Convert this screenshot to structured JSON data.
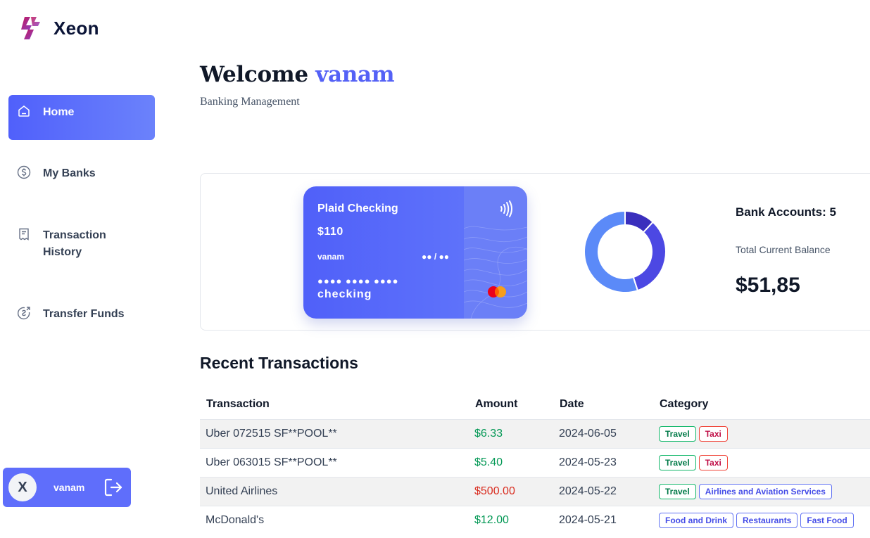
{
  "app": {
    "name": "Xeon"
  },
  "sidebar": {
    "items": [
      {
        "label": "Home",
        "icon": "home-icon",
        "active": true
      },
      {
        "label": "My Banks",
        "icon": "dollar-circle-icon"
      },
      {
        "label": "Transaction History",
        "icon": "receipt-icon"
      },
      {
        "label": "Transfer Funds",
        "icon": "money-send-icon"
      }
    ]
  },
  "user": {
    "initial": "X",
    "name": "vanam"
  },
  "header": {
    "welcome": "Welcome",
    "username": "vanam",
    "subtitle": "Banking Management"
  },
  "card": {
    "name": "Plaid Checking",
    "amount": "$110",
    "holder": "vanam",
    "expiry": "●● / ●●",
    "number_mask": "●●●● ●●●● ●●●●",
    "type": "checking"
  },
  "balance": {
    "accounts_label": "Bank Accounts: 5",
    "total_label": "Total Current Balance",
    "total_value": "$51,85"
  },
  "chart_data": {
    "type": "pie",
    "donut": true,
    "values": [
      12,
      33,
      55
    ],
    "colors": [
      "#3a2fbd",
      "#4c48e3",
      "#5b8af8"
    ]
  },
  "transactions": {
    "title": "Recent Transactions",
    "headers": [
      "Transaction",
      "Amount",
      "Date",
      "Category"
    ],
    "rows": [
      {
        "name": "Uber 072515 SF**POOL**",
        "amount": "$6.33",
        "type": "pos",
        "date": "2024-06-05",
        "tags": [
          {
            "label": "Travel",
            "color": "green"
          },
          {
            "label": "Taxi",
            "color": "red"
          }
        ]
      },
      {
        "name": "Uber 063015 SF**POOL**",
        "amount": "$5.40",
        "type": "pos",
        "date": "2024-05-23",
        "tags": [
          {
            "label": "Travel",
            "color": "green"
          },
          {
            "label": "Taxi",
            "color": "red"
          }
        ]
      },
      {
        "name": "United Airlines",
        "amount": "$500.00",
        "type": "neg",
        "date": "2024-05-22",
        "tags": [
          {
            "label": "Travel",
            "color": "green"
          },
          {
            "label": "Airlines and Aviation Services",
            "color": "blue"
          }
        ]
      },
      {
        "name": "McDonald's",
        "amount": "$12.00",
        "type": "pos",
        "date": "2024-05-21",
        "tags": [
          {
            "label": "Food and Drink",
            "color": "blue"
          },
          {
            "label": "Restaurants",
            "color": "blue"
          },
          {
            "label": "Fast Food",
            "color": "blue"
          }
        ]
      }
    ]
  }
}
